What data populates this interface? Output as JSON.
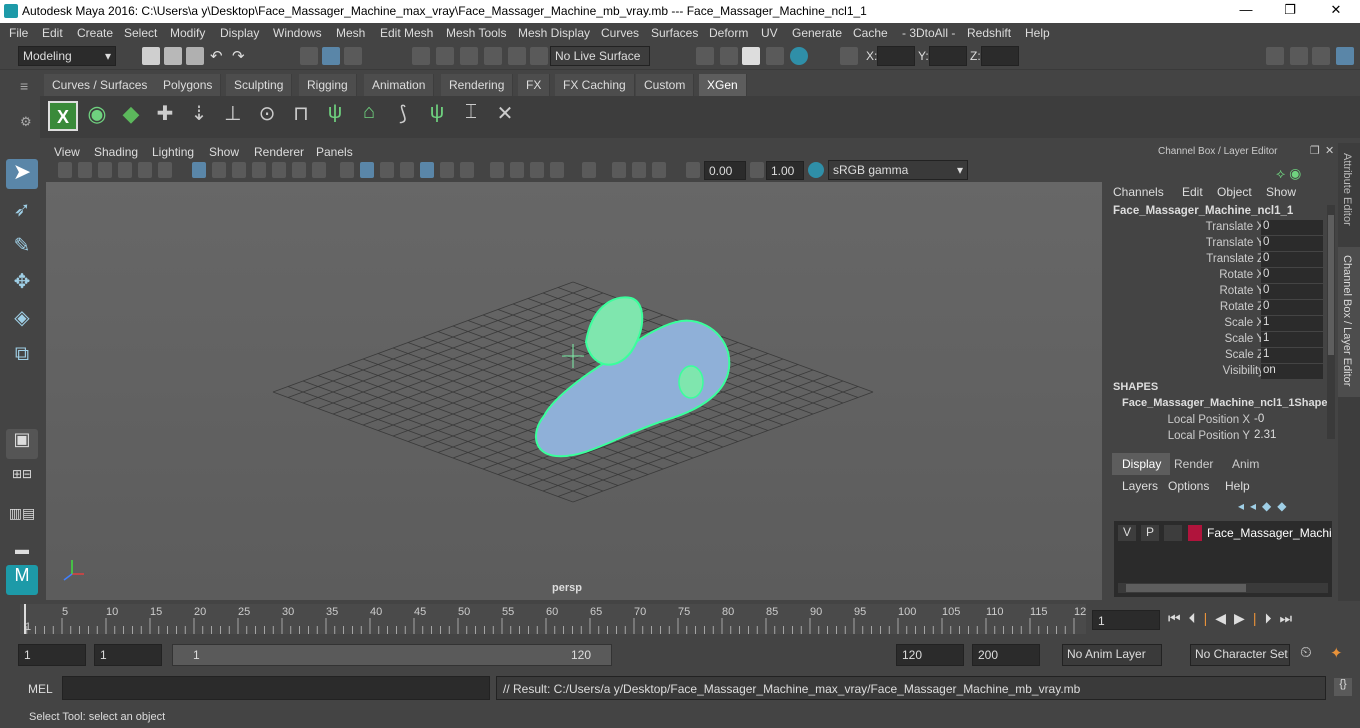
{
  "window": {
    "title": "Autodesk Maya 2016: C:\\Users\\a y\\Desktop\\Face_Massager_Machine_max_vray\\Face_Massager_Machine_mb_vray.mb   ---   Face_Massager_Machine_ncl1_1",
    "min": "—",
    "max": "❐",
    "close": "✕"
  },
  "menu": [
    "File",
    "Edit",
    "Create",
    "Select",
    "Modify",
    "Display",
    "Windows",
    "Mesh",
    "Edit Mesh",
    "Mesh Tools",
    "Mesh Display",
    "Curves",
    "Surfaces",
    "Deform",
    "UV",
    "Generate",
    "Cache",
    "- 3DtoAll -",
    "Redshift",
    "Help"
  ],
  "statusline": {
    "mode": "Modeling",
    "live_surface": "No Live Surface",
    "x_label": "X:",
    "y_label": "Y:",
    "z_label": "Z:"
  },
  "shelf_tabs": [
    "Curves / Surfaces",
    "Polygons",
    "Sculpting",
    "Rigging",
    "Animation",
    "Rendering",
    "FX",
    "FX Caching",
    "Custom",
    "XGen"
  ],
  "active_shelf": "XGen",
  "viewport": {
    "menu": [
      "View",
      "Shading",
      "Lighting",
      "Show",
      "Renderer",
      "Panels"
    ],
    "near": "0.00",
    "far": "1.00",
    "colorspace": "sRGB gamma",
    "camera": "persp"
  },
  "channel_box": {
    "title": "Channel Box / Layer Editor",
    "menu": [
      "Channels",
      "Edit",
      "Object",
      "Show"
    ],
    "object": "Face_Massager_Machine_ncl1_1",
    "channels": [
      {
        "label": "Translate X",
        "value": "0"
      },
      {
        "label": "Translate Y",
        "value": "0"
      },
      {
        "label": "Translate Z",
        "value": "0"
      },
      {
        "label": "Rotate X",
        "value": "0"
      },
      {
        "label": "Rotate Y",
        "value": "0"
      },
      {
        "label": "Rotate Z",
        "value": "0"
      },
      {
        "label": "Scale X",
        "value": "1"
      },
      {
        "label": "Scale Y",
        "value": "1"
      },
      {
        "label": "Scale Z",
        "value": "1"
      },
      {
        "label": "Visibility",
        "value": "on"
      }
    ],
    "shapes_header": "SHAPES",
    "shape_name": "Face_Massager_Machine_ncl1_1Shape",
    "shape_channels": [
      {
        "label": "Local Position X",
        "value": "-0"
      },
      {
        "label": "Local Position Y",
        "value": "2.31"
      }
    ]
  },
  "layer_editor": {
    "tabs": [
      "Display",
      "Render",
      "Anim"
    ],
    "menu": [
      "Layers",
      "Options",
      "Help"
    ],
    "layer": {
      "v": "V",
      "p": "P",
      "name": "Face_Massager_Machine",
      "color": "#b0143c"
    }
  },
  "side_tabs": [
    "Attribute Editor",
    "Channel Box / Layer Editor"
  ],
  "timeline": {
    "ticks": [
      "1",
      "5",
      "10",
      "15",
      "20",
      "25",
      "30",
      "35",
      "40",
      "45",
      "50",
      "55",
      "60",
      "65",
      "70",
      "75",
      "80",
      "85",
      "90",
      "95",
      "100",
      "105",
      "110",
      "115",
      "12"
    ],
    "current_frame": "1"
  },
  "range": {
    "start": "1",
    "playback_start": "1",
    "slider_start": "1",
    "slider_end": "120",
    "playback_end": "120",
    "end": "200",
    "anim_layer": "No Anim Layer",
    "character_set": "No Character Set"
  },
  "command": {
    "label": "MEL",
    "result": "// Result: C:/Users/a y/Desktop/Face_Massager_Machine_max_vray/Face_Massager_Machine_mb_vray.mb"
  },
  "help_line": "Select Tool: select an object"
}
